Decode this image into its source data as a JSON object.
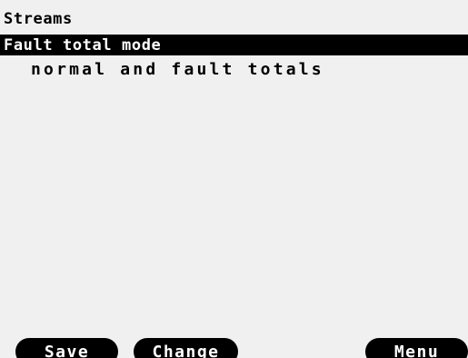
{
  "screen": {
    "title": "Streams",
    "selected_item": {
      "label": "Fault total mode",
      "value": "normal and fault totals"
    }
  },
  "softkeys": {
    "left": "Save",
    "middle": "Change",
    "right": "Menu"
  },
  "colors": {
    "background": "#f0f0f0",
    "foreground": "#000000",
    "highlight_text": "#ffffff"
  }
}
